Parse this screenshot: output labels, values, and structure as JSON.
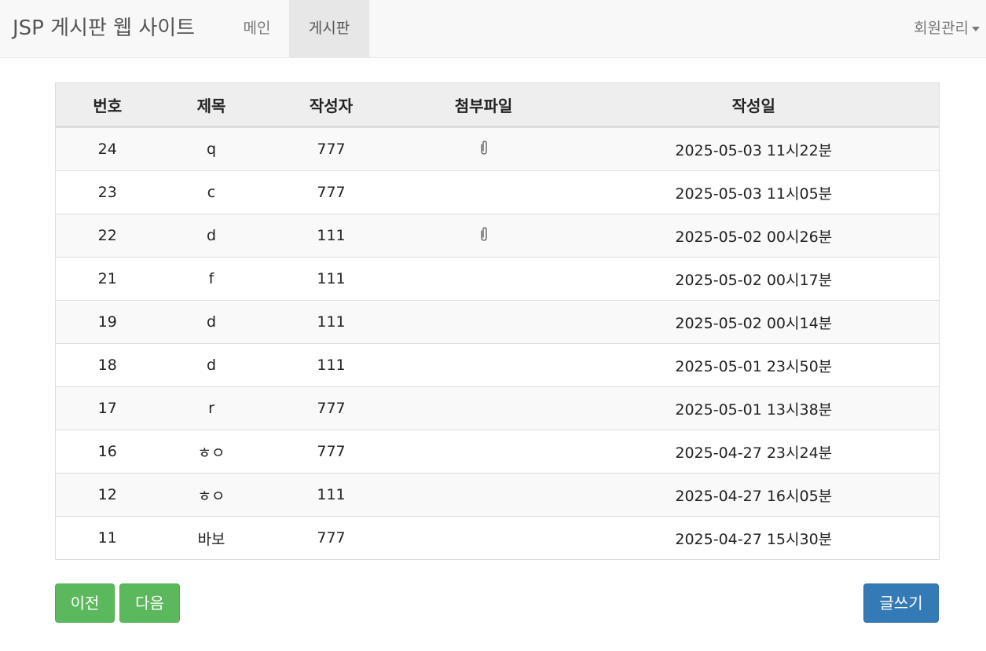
{
  "navbar": {
    "brand": "JSP 게시판 웹 사이트",
    "items": [
      {
        "label": "메인"
      },
      {
        "label": "게시판",
        "active": true
      }
    ],
    "member_menu": "회원관리"
  },
  "table": {
    "headers": [
      "번호",
      "제목",
      "작성자",
      "첨부파일",
      "작성일"
    ],
    "rows": [
      {
        "no": "24",
        "title": "q",
        "author": "777",
        "attachment_icon": "paperclip-icon",
        "date": "2025-05-03 11시22분"
      },
      {
        "no": "23",
        "title": "c",
        "author": "777",
        "attachment_icon": "",
        "date": "2025-05-03 11시05분"
      },
      {
        "no": "22",
        "title": "d",
        "author": "111",
        "attachment_icon": "paperclip-icon",
        "date": "2025-05-02 00시26분"
      },
      {
        "no": "21",
        "title": "f",
        "author": "111",
        "attachment_icon": "",
        "date": "2025-05-02 00시17분"
      },
      {
        "no": "19",
        "title": "d",
        "author": "111",
        "attachment_icon": "",
        "date": "2025-05-02 00시14분"
      },
      {
        "no": "18",
        "title": "d",
        "author": "111",
        "attachment_icon": "",
        "date": "2025-05-01 23시50분"
      },
      {
        "no": "17",
        "title": "r",
        "author": "777",
        "attachment_icon": "",
        "date": "2025-05-01 13시38분"
      },
      {
        "no": "16",
        "title": "ㅎㅇ",
        "author": "777",
        "attachment_icon": "",
        "date": "2025-04-27 23시24분"
      },
      {
        "no": "12",
        "title": "ㅎㅇ",
        "author": "111",
        "attachment_icon": "",
        "date": "2025-04-27 16시05분"
      },
      {
        "no": "11",
        "title": "바보",
        "author": "777",
        "attachment_icon": "",
        "date": "2025-04-27 15시30분"
      }
    ]
  },
  "buttons": {
    "prev": "이전",
    "next": "다음",
    "write": "글쓰기"
  },
  "colors": {
    "success": "#5cb85c",
    "primary": "#337ab7",
    "navbar_bg": "#f8f8f8"
  }
}
